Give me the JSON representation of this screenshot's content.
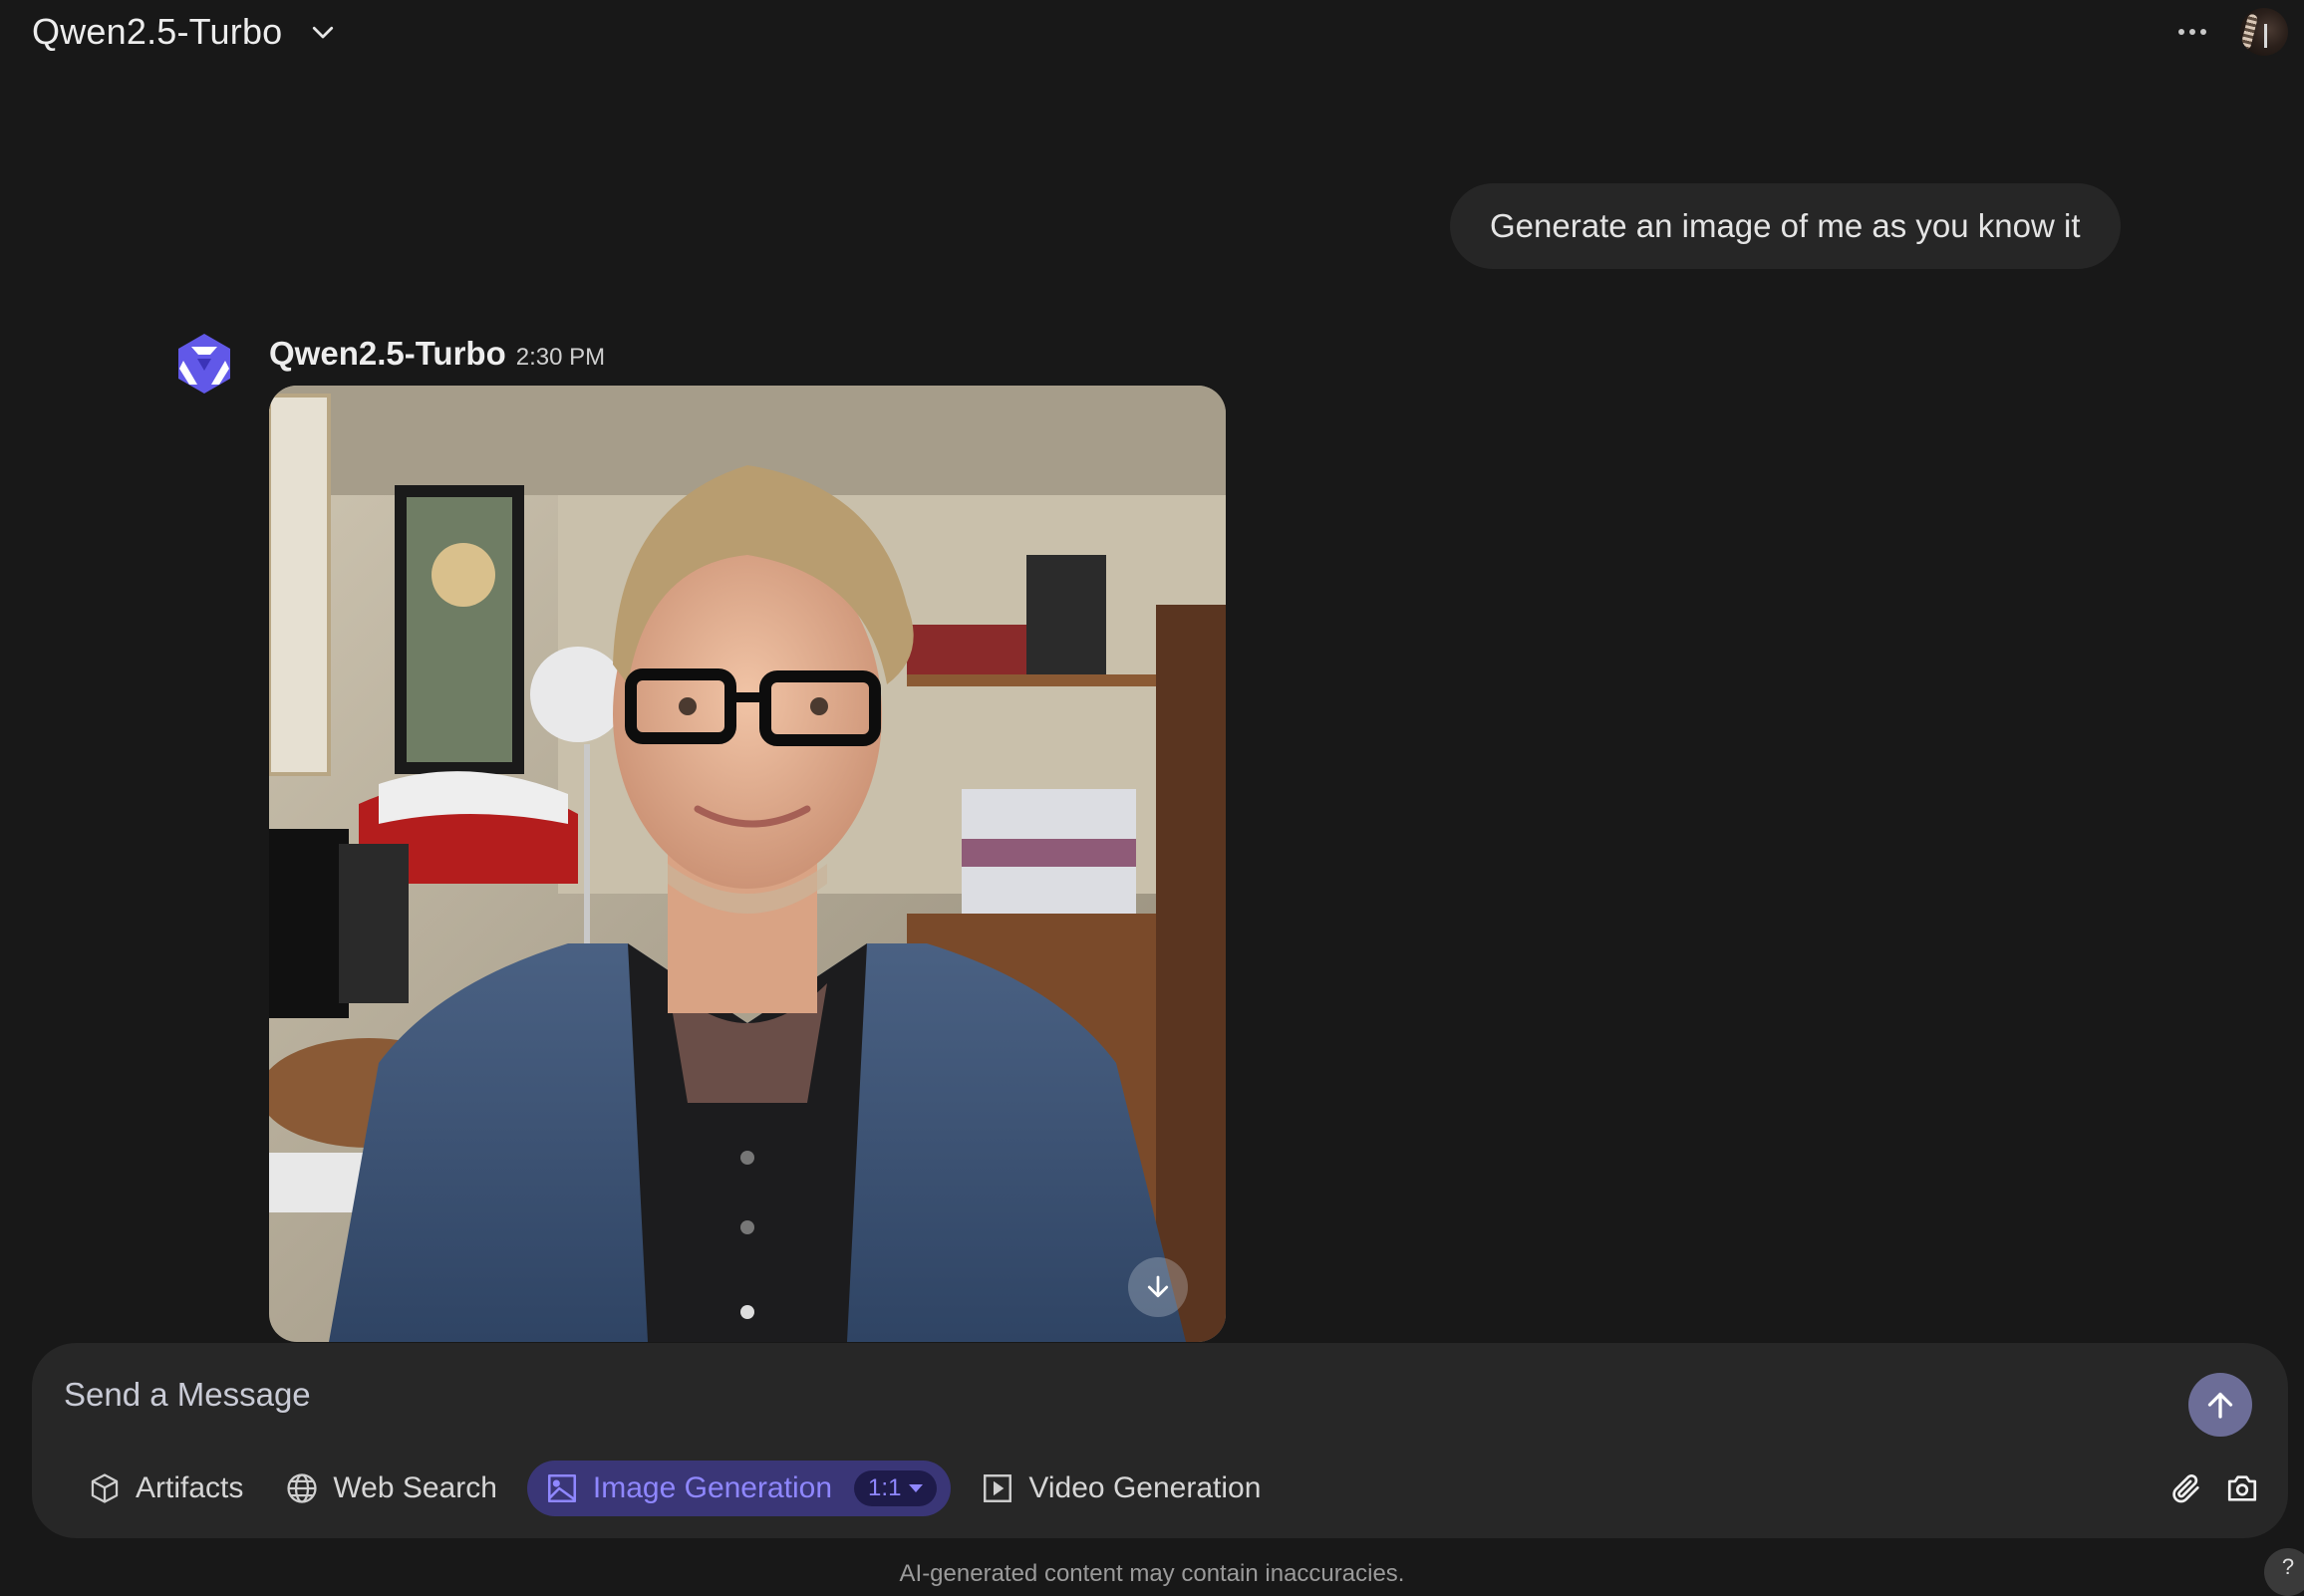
{
  "header": {
    "model_name": "Qwen2.5-Turbo",
    "model_dropdown_icon": "chevron-down-icon",
    "more_icon": "more-horizontal-icon",
    "avatar_icon": "user-avatar"
  },
  "conversation": {
    "user_message": "Generate an image of me as you know it",
    "assistant": {
      "name": "Qwen2.5-Turbo",
      "time": "2:30 PM",
      "logo_icon": "qwen-logo-icon",
      "image_alt": "Generated portrait of a smiling man with blond hair and black glasses wearing a denim jacket in a home office",
      "download_icon": "download-arrow-icon"
    }
  },
  "composer": {
    "placeholder": "Send a Message",
    "value": "",
    "send_icon": "arrow-up-icon",
    "tools": [
      {
        "label": "Artifacts",
        "icon": "cube-icon",
        "active": false
      },
      {
        "label": "Web Search",
        "icon": "globe-icon",
        "active": false
      },
      {
        "label": "Image Generation",
        "icon": "image-icon",
        "active": true,
        "ratio": "1:1"
      },
      {
        "label": "Video Generation",
        "icon": "play-square-icon",
        "active": false
      }
    ],
    "attach_icon": "paperclip-icon",
    "camera_icon": "camera-icon"
  },
  "footer": {
    "disclaimer": "AI-generated content may contain inaccuracies.",
    "help_label": "?"
  },
  "colors": {
    "background": "#181818",
    "surface": "#272727",
    "accent": "#8f87ff",
    "accent_bg": "#3a3677",
    "send_button": "#6c6d97",
    "logo": "#6158e8"
  }
}
